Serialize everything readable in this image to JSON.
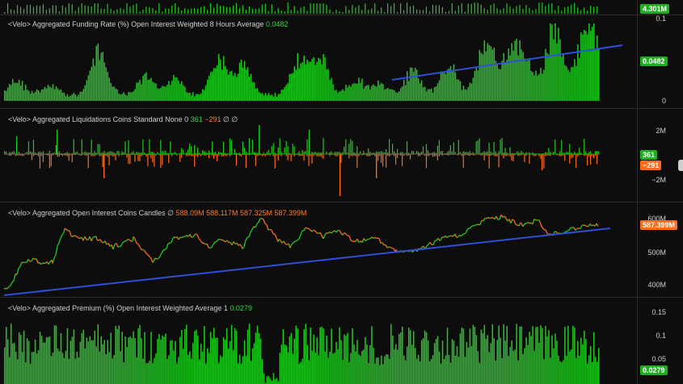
{
  "colors": {
    "green": "#22c922",
    "orange": "#ff6a1a",
    "trend": "#2f4fd8",
    "text": "#d9d9d9"
  },
  "top_strip": {
    "last_value": "4.301M"
  },
  "funding": {
    "title_prefix": "<Velo> Aggregated Funding Rate (%) Open Interest Weighted 8 Hours Average",
    "title_value": "0.0482",
    "ticks": [
      "0.1",
      "0"
    ],
    "last_value": "0.0482"
  },
  "liquidations": {
    "title_prefix": "<Velo> Aggregated Liquidations Coins Standard None 0",
    "long_value": "361",
    "short_value": "−291",
    "extra": "∅ ∅",
    "ticks": [
      "2M",
      "−2M"
    ],
    "last_long": "361",
    "last_short": "−291"
  },
  "open_interest": {
    "title_prefix": "<Velo> Aggregated Open Interest Coins Candles",
    "title_sym": "∅",
    "ohlc": [
      "588.09M",
      "588.117M",
      "587.325M",
      "587.399M"
    ],
    "ticks": [
      "600M",
      "500M",
      "400M"
    ],
    "last_value": "587.399M"
  },
  "premium": {
    "title_prefix": "<Velo> Aggregated Premium (%) Open Interest Weighted Average 1",
    "title_value": "0.0279",
    "ticks": [
      "0.15",
      "0.1",
      "0.05"
    ],
    "last_value": "0.0279"
  },
  "chart_data": [
    {
      "type": "bar",
      "title": "<Velo> Aggregated Funding Rate (%) Open Interest Weighted 8 Hours Average",
      "ylim": [
        0,
        0.11
      ],
      "last": 0.0482
    },
    {
      "type": "bar",
      "title": "<Velo> Aggregated Liquidations Coins Standard None 0",
      "ylim": [
        -2500000,
        2500000
      ]
    },
    {
      "type": "line",
      "title": "<Velo> Aggregated Open Interest Coins Candles",
      "ylim": [
        375000000,
        620000000
      ],
      "last": 587399000
    },
    {
      "type": "bar",
      "title": "<Velo> Aggregated Premium (%) Open Interest Weighted Average 1",
      "ylim": [
        0,
        0.16
      ],
      "last": 0.0279
    }
  ]
}
